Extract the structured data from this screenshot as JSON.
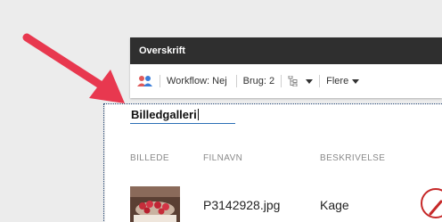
{
  "toolbar": {
    "title": "Overskrift",
    "workflow_label": "Workflow: Nej",
    "usage_label": "Brug: 2",
    "more_label": "Flere"
  },
  "editor": {
    "field_value": "Billedgalleri"
  },
  "table": {
    "columns": [
      "BILLEDE",
      "FILNAVN",
      "BESKRIVELSE"
    ],
    "rows": [
      {
        "filename": "P3142928.jpg",
        "description": "Kage"
      }
    ]
  },
  "colors": {
    "arrow": "#e8384f",
    "toolbar_header": "#2f2f2f",
    "field_underline": "#2a6fb6",
    "edit_button": "#c62828"
  },
  "icons": [
    "users-icon",
    "tree-icon",
    "dropdown-caret-icon",
    "edit-pencil-icon"
  ]
}
